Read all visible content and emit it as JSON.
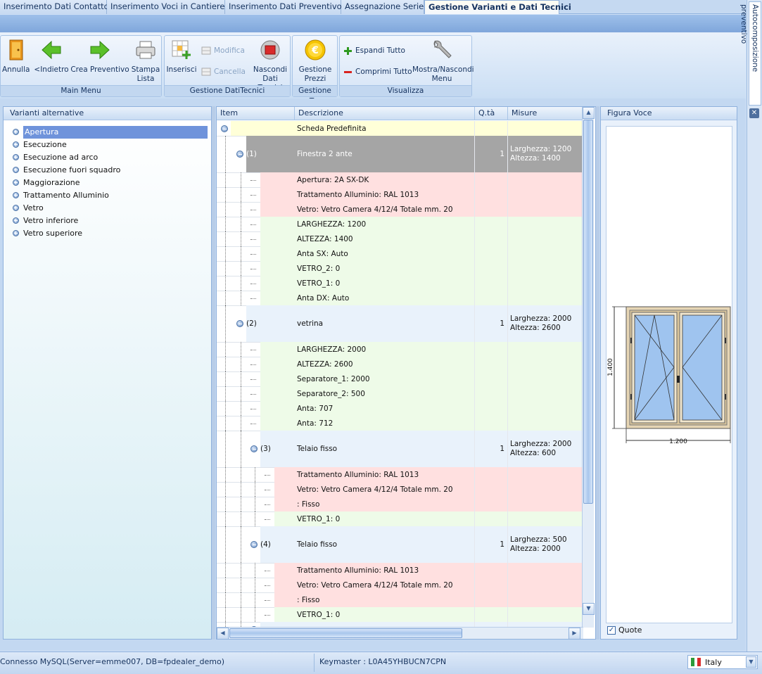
{
  "tabs": [
    {
      "label": "Inserimento Dati Contatto",
      "active": false,
      "w": 152
    },
    {
      "label": "Inserimento Voci in Cantiere",
      "active": false,
      "w": 168
    },
    {
      "label": "Inserimento Dati Preventivo",
      "active": false,
      "w": 165
    },
    {
      "label": "Assegnazione Serie",
      "active": false,
      "w": 118
    },
    {
      "label": "Gestione Varianti e Dati Tecnici",
      "active": true,
      "w": 192
    }
  ],
  "ribbon": {
    "annulla": "Annulla",
    "indietro": "<Indietro",
    "crea_preventivo": "Crea Preventivo",
    "stampa1": "Stampa",
    "stampa2": "Lista",
    "main_menu": "Main Menu",
    "inserisci": "Inserisci",
    "modifica": "Modifica",
    "cancella": "Cancella",
    "nascondi1": "Nascondi",
    "nascondi2": "Dati Tecnici",
    "gestione_dati_tecnici": "Gestione DatiTecnici",
    "gestione1": "Gestione",
    "gestione2": "Prezzi",
    "gestione_t": "Gestione T...",
    "espandi": "Espandi Tutto",
    "comprimi": "Comprimi Tutto",
    "mostra1": "Mostra/Nascondi",
    "mostra2": "Menu",
    "visualizza": "Visualizza"
  },
  "left_panel": {
    "title": "Varianti alternative",
    "items": [
      "Apertura",
      "Esecuzione",
      "Esecuzione ad arco",
      "Esecuzione fuori squadro",
      "Maggiorazione",
      "Trattamento Alluminio",
      "Vetro",
      "Vetro inferiore",
      "Vetro superiore"
    ],
    "selected": 0
  },
  "grid": {
    "columns": [
      "Item",
      "Descrizione",
      "Q.tà",
      "Misure"
    ],
    "rows": [
      {
        "type": "root",
        "item": "",
        "desc": "Scheda Predefinita",
        "qty": "",
        "m1": "",
        "m2": "",
        "h": 21,
        "level": 0
      },
      {
        "type": "group",
        "item": "(1)",
        "desc": "Finestra 2 ante",
        "qty": "1",
        "m1": "Larghezza: 1200",
        "m2": "Altezza: 1400",
        "h": 52,
        "level": 1,
        "dark": true
      },
      {
        "type": "variant",
        "desc": "Apertura: 2A SX-DK",
        "h": 21,
        "level": 2
      },
      {
        "type": "variant",
        "desc": "Trattamento Alluminio: RAL 1013",
        "h": 21,
        "level": 2
      },
      {
        "type": "variant",
        "desc": "Vetro: Vetro Camera 4/12/4 Totale mm. 20",
        "h": 21,
        "level": 2
      },
      {
        "type": "data",
        "desc": "LARGHEZZA: 1200",
        "h": 21,
        "level": 2
      },
      {
        "type": "data",
        "desc": "ALTEZZA: 1400",
        "h": 21,
        "level": 2
      },
      {
        "type": "data",
        "desc": "Anta SX: Auto",
        "h": 21,
        "level": 2
      },
      {
        "type": "data",
        "desc": "VETRO_2: 0",
        "h": 21,
        "level": 2
      },
      {
        "type": "data",
        "desc": "VETRO_1: 0",
        "h": 21,
        "level": 2
      },
      {
        "type": "data",
        "desc": "Anta DX: Auto",
        "h": 21,
        "level": 2
      },
      {
        "type": "group",
        "item": "(2)",
        "desc": "vetrina",
        "qty": "1",
        "m1": "Larghezza: 2000",
        "m2": "Altezza: 2600",
        "h": 52,
        "level": 1
      },
      {
        "type": "data",
        "desc": "LARGHEZZA: 2000",
        "h": 21,
        "level": 2
      },
      {
        "type": "data",
        "desc": "ALTEZZA: 2600",
        "h": 21,
        "level": 2
      },
      {
        "type": "data",
        "desc": "Separatore_1: 2000",
        "h": 21,
        "level": 2
      },
      {
        "type": "data",
        "desc": "Separatore_2: 500",
        "h": 21,
        "level": 2
      },
      {
        "type": "data",
        "desc": "Anta: 707",
        "h": 21,
        "level": 2
      },
      {
        "type": "data",
        "desc": "Anta: 712",
        "h": 21,
        "level": 2
      },
      {
        "type": "group",
        "item": "(3)",
        "desc": "Telaio fisso",
        "qty": "1",
        "m1": "Larghezza: 2000",
        "m2": "Altezza: 600",
        "h": 52,
        "level": 2
      },
      {
        "type": "variant",
        "desc": "Trattamento Alluminio: RAL 1013",
        "h": 21,
        "level": 3
      },
      {
        "type": "variant",
        "desc": "Vetro: Vetro Camera 4/12/4 Totale mm. 20",
        "h": 21,
        "level": 3
      },
      {
        "type": "variant",
        "desc": ": Fisso",
        "h": 21,
        "level": 3
      },
      {
        "type": "data",
        "desc": "VETRO_1: 0",
        "h": 21,
        "level": 3
      },
      {
        "type": "group",
        "item": "(4)",
        "desc": "Telaio fisso",
        "qty": "1",
        "m1": "Larghezza: 500",
        "m2": "Altezza: 2000",
        "h": 52,
        "level": 2
      },
      {
        "type": "variant",
        "desc": "Trattamento Alluminio: RAL 1013",
        "h": 21,
        "level": 3
      },
      {
        "type": "variant",
        "desc": "Vetro: Vetro Camera 4/12/4 Totale mm. 20",
        "h": 21,
        "level": 3
      },
      {
        "type": "variant",
        "desc": ": Fisso",
        "h": 21,
        "level": 3
      },
      {
        "type": "data",
        "desc": "VETRO_1: 0",
        "h": 21,
        "level": 3
      },
      {
        "type": "group",
        "item": "",
        "desc": "",
        "qty": "",
        "m1": "",
        "m2": "",
        "h": 21,
        "level": 2
      }
    ]
  },
  "figure_panel": {
    "title": "Figura Voce",
    "width_label": "1.200",
    "height_label": "1.400",
    "quote_label": "Quote",
    "quote_checked": true
  },
  "side_tab": {
    "label": "Autocomposizione preventivo"
  },
  "status": {
    "connection": "Connesso MySQL(Server=emme007, DB=fpdealer_demo)",
    "keymaster": "Keymaster : L0A45YHBUCN7CPN",
    "language": "Italy"
  },
  "colors": {
    "variant_bg": "#ffe0e0",
    "data_bg": "#eefbe8",
    "group_bg": "#e9f2fb",
    "dark_group_bg": "#a5a5a5",
    "root_bg": "#ffffd8",
    "selection": "#6f93db"
  }
}
